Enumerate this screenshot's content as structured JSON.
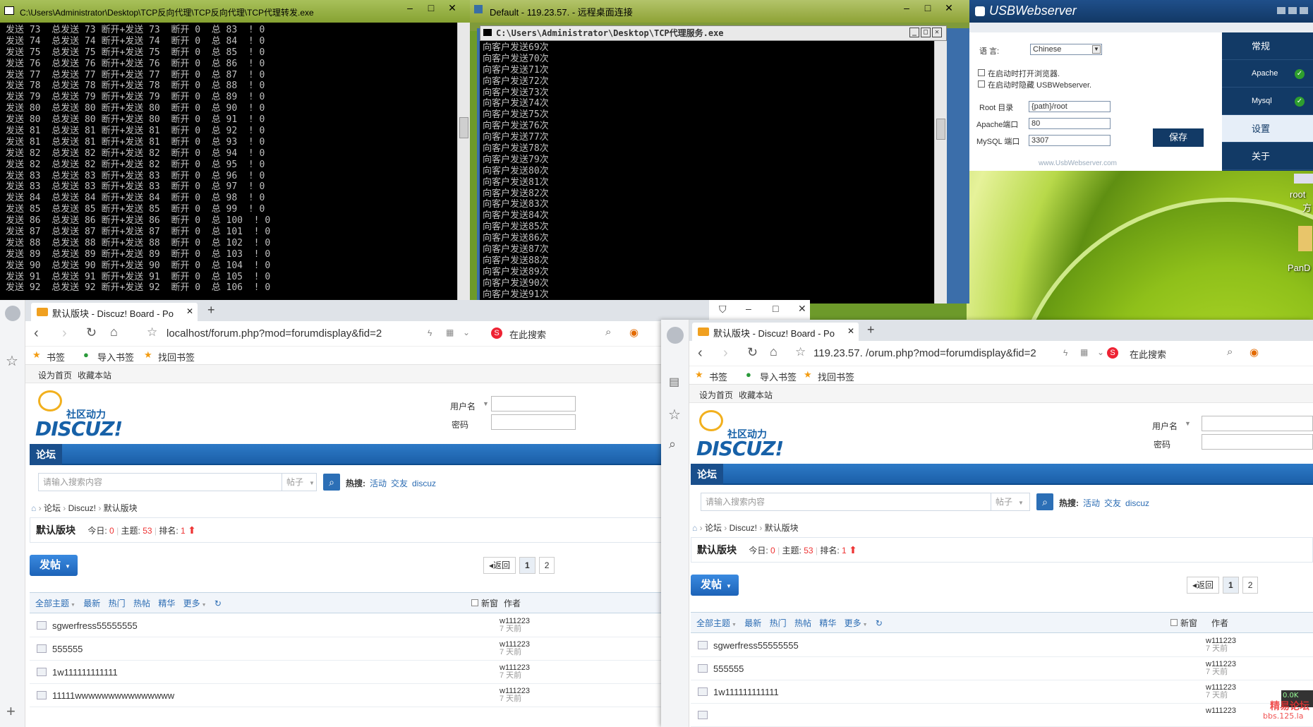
{
  "console1": {
    "title": "C:\\Users\\Administrator\\Desktop\\TCP反向代理\\TCP反向代理\\TCP代理转发.exe",
    "lines": [
      "发送 73  总发送 73 断开+发送 73  断开 0  总 83  ! 0",
      "发送 74  总发送 74 断开+发送 74  断开 0  总 84  ! 0",
      "发送 75  总发送 75 断开+发送 75  断开 0  总 85  ! 0",
      "发送 76  总发送 76 断开+发送 76  断开 0  总 86  ! 0",
      "发送 77  总发送 77 断开+发送 77  断开 0  总 87  ! 0",
      "发送 78  总发送 78 断开+发送 78  断开 0  总 88  ! 0",
      "发送 79  总发送 79 断开+发送 79  断开 0  总 89  ! 0",
      "发送 80  总发送 80 断开+发送 80  断开 0  总 90  ! 0",
      "发送 80  总发送 80 断开+发送 80  断开 0  总 91  ! 0",
      "发送 81  总发送 81 断开+发送 81  断开 0  总 92  ! 0",
      "发送 81  总发送 81 断开+发送 81  断开 0  总 93  ! 0",
      "发送 82  总发送 82 断开+发送 82  断开 0  总 94  ! 0",
      "发送 82  总发送 82 断开+发送 82  断开 0  总 95  ! 0",
      "发送 83  总发送 83 断开+发送 83  断开 0  总 96  ! 0",
      "发送 83  总发送 83 断开+发送 83  断开 0  总 97  ! 0",
      "发送 84  总发送 84 断开+发送 84  断开 0  总 98  ! 0",
      "发送 85  总发送 85 断开+发送 85  断开 0  总 99  ! 0",
      "发送 86  总发送 86 断开+发送 86  断开 0  总 100  ! 0",
      "发送 87  总发送 87 断开+发送 87  断开 0  总 101  ! 0",
      "发送 88  总发送 88 断开+发送 88  断开 0  总 102  ! 0",
      "发送 89  总发送 89 断开+发送 89  断开 0  总 103  ! 0",
      "发送 90  总发送 90 断开+发送 90  断开 0  总 104  ! 0",
      "发送 91  总发送 91 断开+发送 91  断开 0  总 105  ! 0",
      "发送 92  总发送 92 断开+发送 92  断开 0  总 106  ! 0"
    ]
  },
  "rdp": {
    "title": "Default - 119.23.57.   - 远程桌面连接"
  },
  "console2": {
    "title": "C:\\Users\\Administrator\\Desktop\\TCP代理服务.exe",
    "lines": [
      "向客户发送69次",
      "向客户发送70次",
      "向客户发送71次",
      "向客户发送72次",
      "向客户发送73次",
      "向客户发送74次",
      "向客户发送75次",
      "向客户发送76次",
      "向客户发送77次",
      "向客户发送78次",
      "向客户发送79次",
      "向客户发送80次",
      "向客户发送81次",
      "向客户发送82次",
      "向客户发送83次",
      "向客户发送84次",
      "向客户发送85次",
      "向客户发送86次",
      "向客户发送87次",
      "向客户发送88次",
      "向客户发送89次",
      "向客户发送90次",
      "向客户发送91次"
    ]
  },
  "usb": {
    "title": "USBWebserver",
    "language_label": "语    言:",
    "language_value": "Chinese",
    "check1": "在启动时打开浏览器.",
    "check2": "在启动时隐藏 USBWebserver.",
    "root_label": "Root 目录",
    "root_value": "{path}/root",
    "apache_label": "Apache端口",
    "apache_value": "80",
    "mysql_label": "MySQL 端口",
    "mysql_value": "3307",
    "save": "保存",
    "footer": "www.UsbWebserver.com",
    "side": [
      "常规",
      "Apache",
      "Mysql",
      "设置",
      "关于"
    ]
  },
  "desktop": {
    "icon1": "root",
    "icon1b": "方",
    "icon2": "PanD"
  },
  "browsers": [
    {
      "tab_title": "默认版块 - Discuz! Board - Powered",
      "url": "localhost/forum.php?mod=forumdisplay&fid=2",
      "search_engine": "在此搜索",
      "bookmarks": [
        "书签",
        "导入书签",
        "找回书签"
      ],
      "toplinks": [
        "设为首页",
        "收藏本站"
      ],
      "logo_sub": "社区动力",
      "logo": "DISCUZ!",
      "login_user": "用户名",
      "login_pass": "密码",
      "nav_current": "论坛",
      "search_placeholder": "请输入搜索内容",
      "search_type": "帖子",
      "hot_label": "热搜:",
      "hot": [
        "活动",
        "交友",
        "discuz"
      ],
      "crumbs": [
        "论坛",
        "Discuz!",
        "默认版块"
      ],
      "forum_name": "默认版块",
      "today_label": "今日:",
      "today": "0",
      "topics_label": "主题:",
      "topics": "53",
      "rank_label": "排名:",
      "rank": "1",
      "post_btn": "发帖",
      "back": "返回",
      "pages": [
        "1",
        "2"
      ],
      "filters": [
        "全部主题",
        "最新",
        "热门",
        "热帖",
        "精华",
        "更多"
      ],
      "new_label": "新窗",
      "author_col": "作者",
      "threads": [
        {
          "title": "sgwerfress55555555",
          "author": "w111223",
          "time": "7 天前"
        },
        {
          "title": "555555",
          "author": "w111223",
          "time": "7 天前"
        },
        {
          "title": "1w111111111111",
          "author": "w111223",
          "time": "7 天前"
        },
        {
          "title": "11111wwwwwwwwwwwwwww",
          "author": "w111223",
          "time": "7 天前"
        }
      ]
    },
    {
      "tab_title": "默认版块 - Discuz! Board - Powered",
      "url": "119.23.57.    /orum.php?mod=forumdisplay&fid=2",
      "search_engine": "在此搜索",
      "bookmarks": [
        "书签",
        "导入书签",
        "找回书签"
      ],
      "toplinks": [
        "设为首页",
        "收藏本站"
      ],
      "logo_sub": "社区动力",
      "logo": "DISCUZ!",
      "login_user": "用户名",
      "login_pass": "密码",
      "nav_current": "论坛",
      "search_placeholder": "请输入搜索内容",
      "search_type": "帖子",
      "hot_label": "热搜:",
      "hot": [
        "活动",
        "交友",
        "discuz"
      ],
      "crumbs": [
        "论坛",
        "Discuz!",
        "默认版块"
      ],
      "forum_name": "默认版块",
      "today_label": "今日:",
      "today": "0",
      "topics_label": "主题:",
      "topics": "53",
      "rank_label": "排名:",
      "rank": "1",
      "post_btn": "发帖",
      "back": "返回",
      "pages": [
        "1",
        "2"
      ],
      "filters": [
        "全部主题",
        "最新",
        "热门",
        "热帖",
        "精华",
        "更多"
      ],
      "new_label": "新窗",
      "author_col": "作者",
      "threads": [
        {
          "title": "sgwerfress55555555",
          "author": "w111223",
          "time": "7 天前"
        },
        {
          "title": "555555",
          "author": "w111223",
          "time": "7 天前"
        },
        {
          "title": "1w111111111111",
          "author": "w111223",
          "time": "7 天前"
        },
        {
          "title": "",
          "author": "w111223",
          "time": ""
        }
      ]
    }
  ],
  "watermark": "精易论坛",
  "watermark2": "bbs.125.la",
  "netspeed": "0.0K"
}
